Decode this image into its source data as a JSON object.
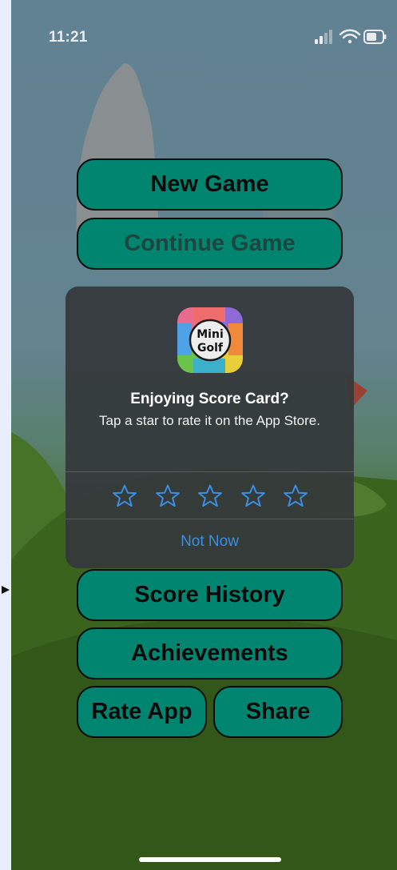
{
  "status_bar": {
    "time": "11:21"
  },
  "menu": {
    "new_game": "New Game",
    "continue_game": "Continue Game",
    "score_history": "Score History",
    "achievements": "Achievements",
    "rate_app": "Rate App",
    "share": "Share"
  },
  "rating_alert": {
    "app_icon_text_line1": "Mini",
    "app_icon_text_line2": "Golf",
    "title": "Enjoying Score Card?",
    "message": "Tap a star to rate it on the App Store.",
    "star_count": 5,
    "dismiss_label": "Not Now"
  },
  "colors": {
    "button_fill": "#00927a",
    "alert_background": "#34383a",
    "link_blue": "#3a8fe4"
  }
}
